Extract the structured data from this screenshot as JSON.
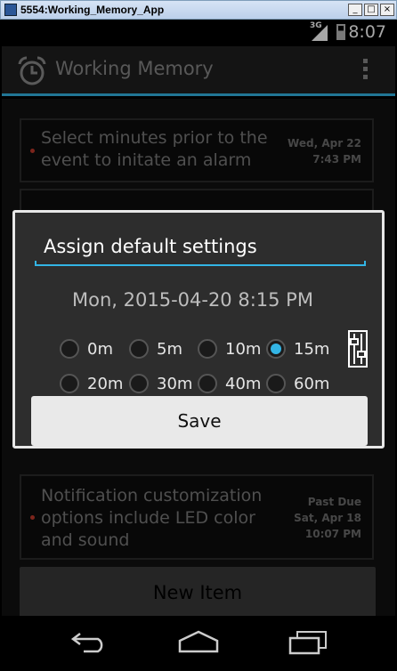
{
  "window": {
    "title": "5554:Working_Memory_App",
    "buttons": [
      "_",
      "□",
      "×"
    ]
  },
  "status_bar": {
    "network": "3G",
    "time": "8:07"
  },
  "action_bar": {
    "title": "Working Memory",
    "icons": [
      "alarm-clock-icon",
      "overflow-menu-icon"
    ]
  },
  "list": {
    "items": [
      {
        "text_line1": "Select minutes prior to the",
        "text_line2": "event to initate an alarm",
        "date_line1": "Wed, Apr 22",
        "date_line2": "7:43 PM"
      },
      {
        "text_line1": "Notification customization",
        "text_line2": "options include LED color",
        "text_line3": "and sound",
        "status": "Past Due",
        "date_line1": "Sat, Apr 18",
        "date_line2": "10:07 PM"
      }
    ]
  },
  "dialog": {
    "title": "Assign default settings",
    "datetime": "Mon, 2015-04-20  8:15 PM",
    "options": [
      "0m",
      "5m",
      "10m",
      "15m",
      "20m",
      "30m",
      "40m",
      "60m"
    ],
    "selected": "15m",
    "save_label": "Save"
  },
  "new_item_label": "New Item",
  "nav_bar": {
    "icons": [
      "back-icon",
      "home-icon",
      "recents-icon"
    ]
  },
  "colors": {
    "accent": "#33b5e5",
    "dot": "#c0392b"
  }
}
